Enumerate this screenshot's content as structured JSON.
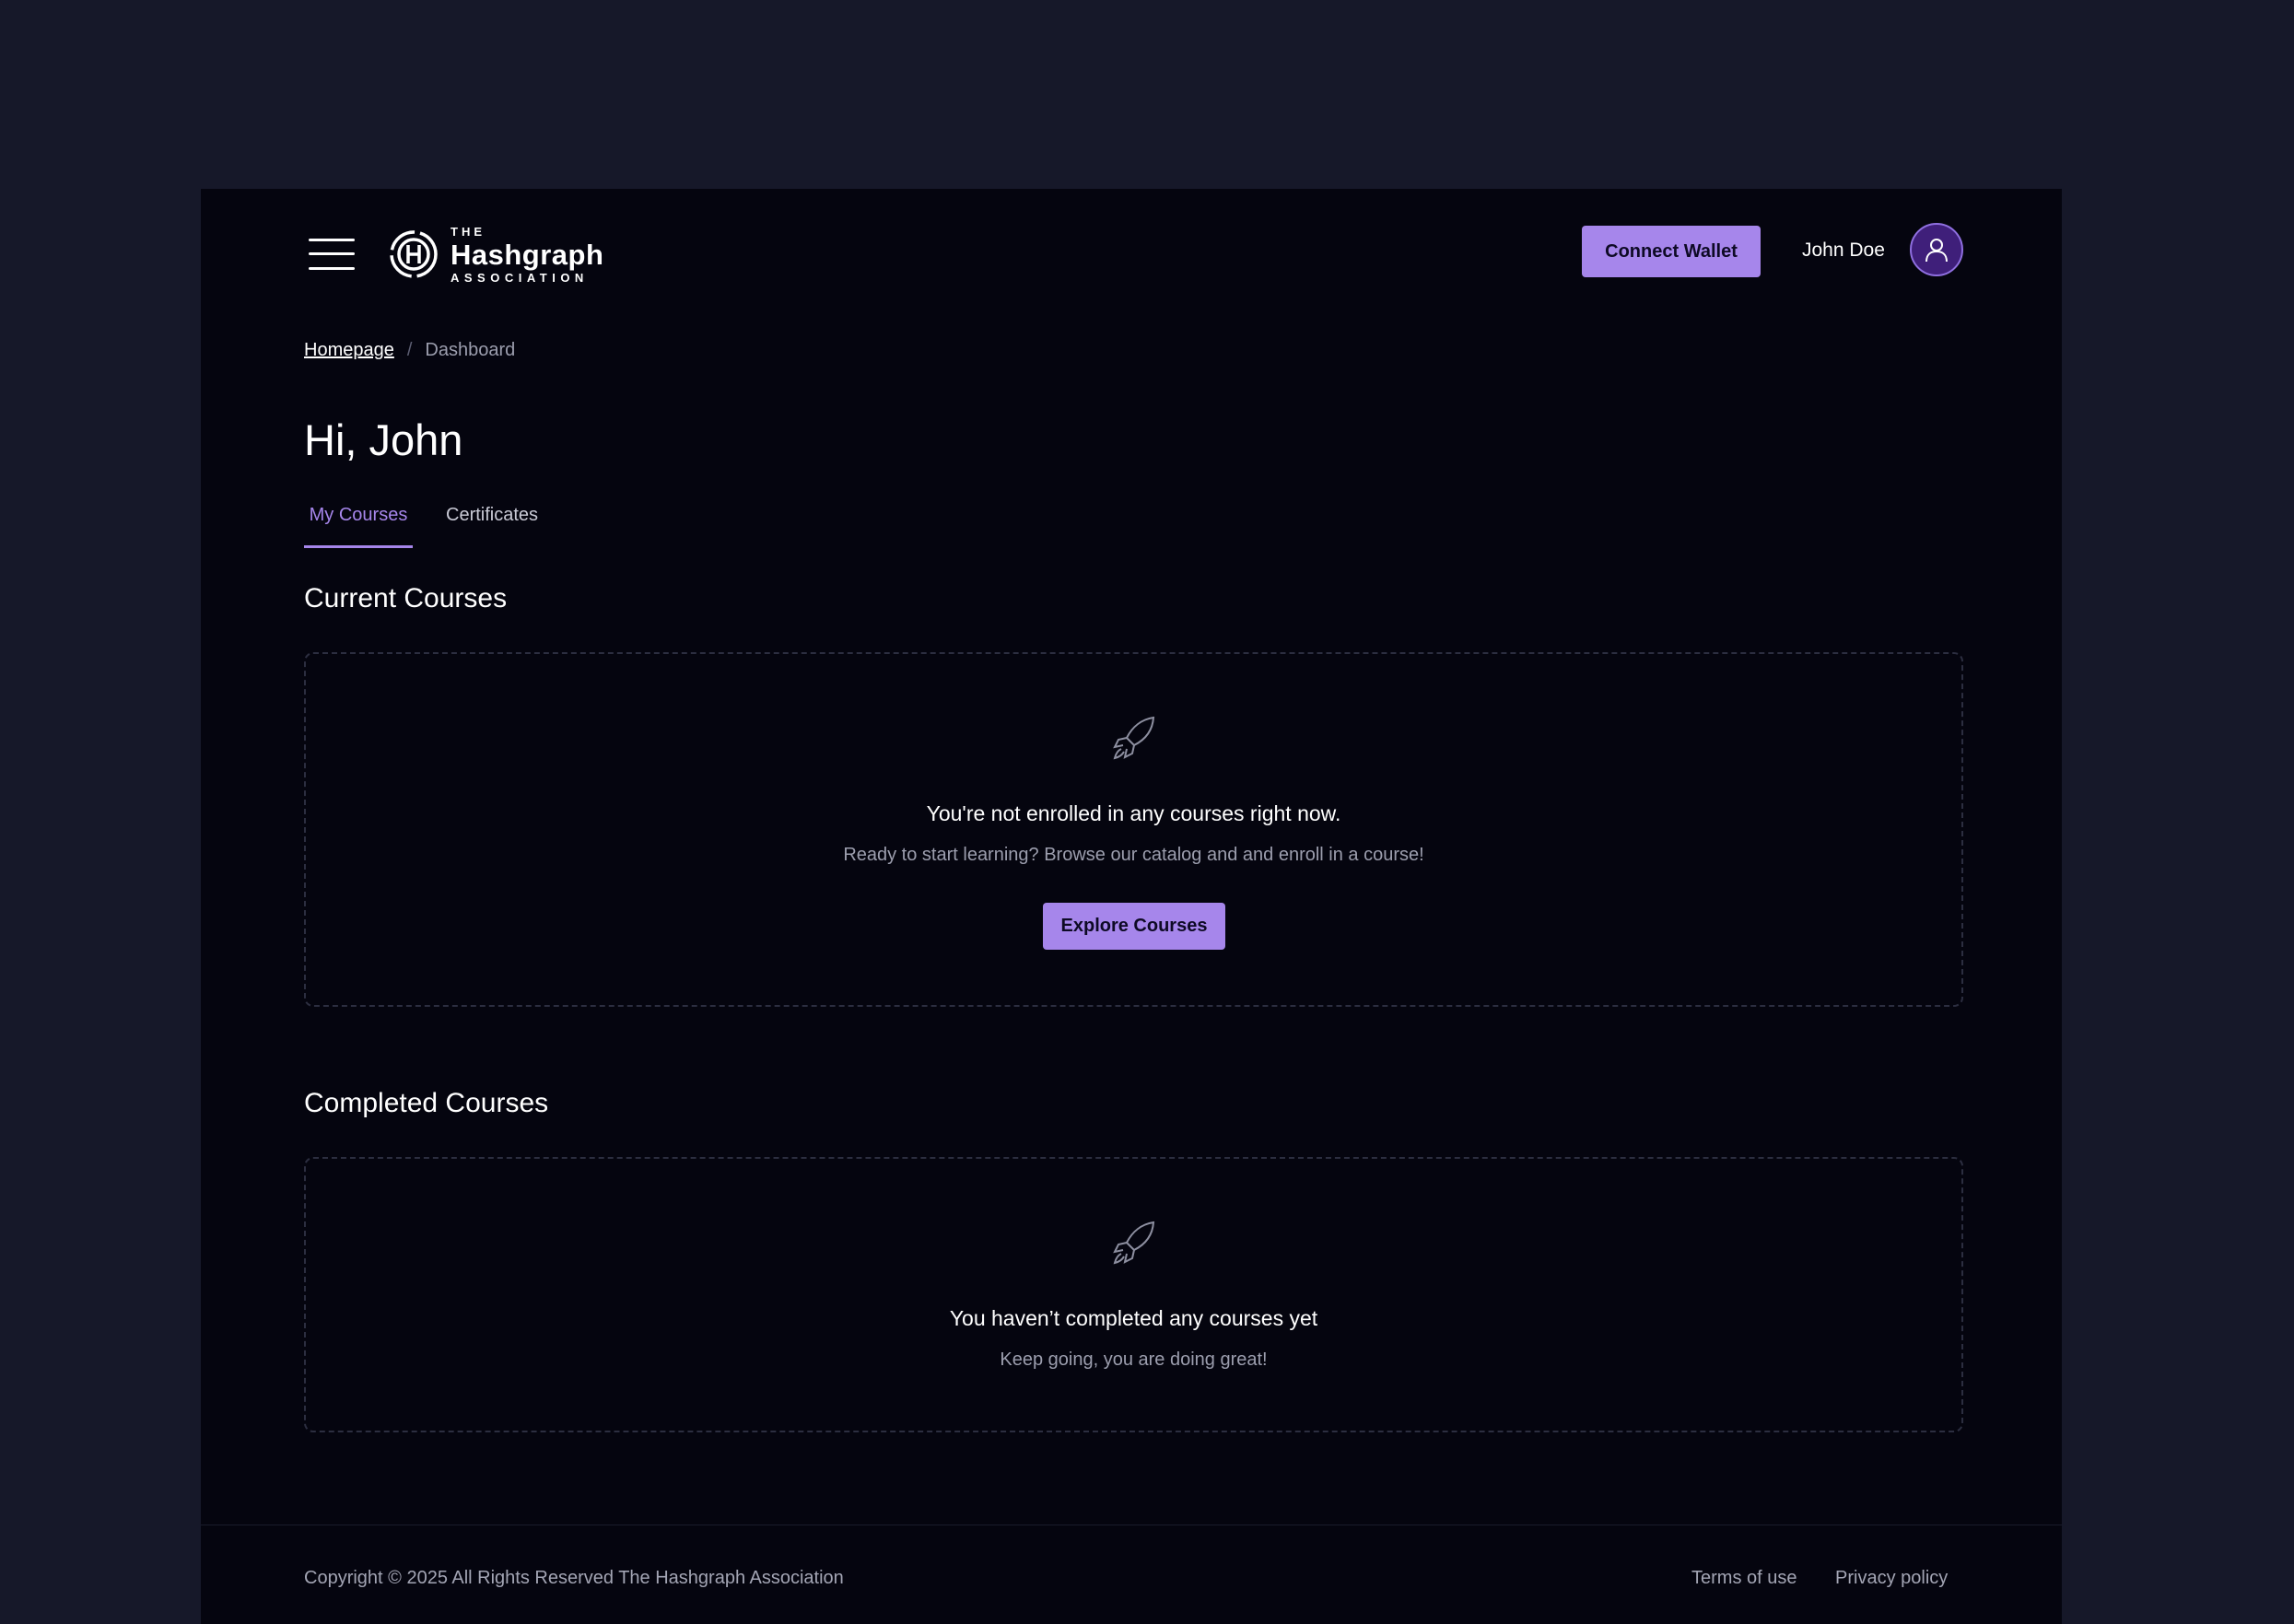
{
  "header": {
    "logo": {
      "line1": "THE",
      "line2": "Hashgraph",
      "line3": "ASSOCIATION"
    },
    "connect_wallet_label": "Connect Wallet",
    "user_name": "John Doe",
    "menu_icon": "hamburger-menu-icon",
    "avatar_icon": "user-icon"
  },
  "breadcrumb": {
    "items": [
      "Homepage",
      "Dashboard"
    ],
    "separator": "/"
  },
  "greeting": "Hi, John",
  "tabs": [
    {
      "label": "My Courses",
      "active": true
    },
    {
      "label": "Certificates",
      "active": false
    }
  ],
  "current_courses": {
    "title": "Current Courses",
    "icon": "rocket-icon",
    "empty_title": "You're not enrolled in any courses right now.",
    "empty_subtitle": "Ready to start learning? Browse our catalog and and enroll in a course!",
    "button_label": "Explore Courses"
  },
  "completed_courses": {
    "title": "Completed Courses",
    "icon": "rocket-icon",
    "empty_title": "You haven’t completed any courses yet",
    "empty_subtitle": "Keep going, you are doing great!"
  },
  "footer": {
    "copyright": "Copyright © 2025 All Rights Reserved The Hashgraph Association",
    "links": [
      "Terms of use",
      "Privacy policy"
    ]
  },
  "colors": {
    "accent": "#a686eb",
    "background": "#05050f",
    "outer_background": "#161829"
  }
}
